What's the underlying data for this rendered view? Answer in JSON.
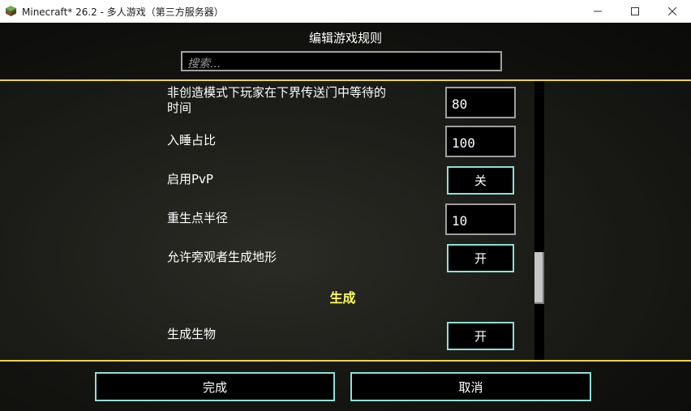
{
  "window": {
    "title": "Minecraft* 26.2 - 多人游戏（第三方服务器）",
    "app_icon": "grass-block-icon",
    "controls": {
      "minimize": "minimize-icon",
      "maximize": "maximize-icon",
      "close": "close-icon"
    }
  },
  "screen": {
    "title": "编辑游戏规则",
    "search_placeholder": "搜索..."
  },
  "rules": [
    {
      "label_line1": "非创造模式下玩家在下界传送门中等待的",
      "label_line2": "时间",
      "type": "number",
      "value": "80"
    },
    {
      "label": "入睡占比",
      "type": "number",
      "value": "100"
    },
    {
      "label": "启用PvP",
      "type": "toggle",
      "value": "关"
    },
    {
      "label": "重生点半径",
      "type": "number",
      "value": "10"
    },
    {
      "label": "允许旁观者生成地形",
      "type": "toggle",
      "value": "开"
    }
  ],
  "category": {
    "label": "生成"
  },
  "category_rules": [
    {
      "label": "生成生物",
      "type": "toggle",
      "value": "开"
    }
  ],
  "footer": {
    "done_label": "完成",
    "cancel_label": "取消"
  },
  "colors": {
    "accent_separator": "#e8d44d",
    "category_text": "#ffff55",
    "button_border": "#8ee0d6"
  }
}
